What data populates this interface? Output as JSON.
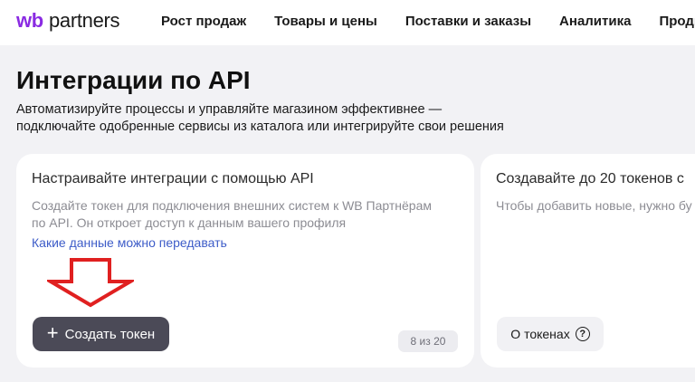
{
  "header": {
    "logo_wb": "wb",
    "logo_partners": "partners",
    "nav": [
      {
        "label": "Рост продаж"
      },
      {
        "label": "Товары и цены"
      },
      {
        "label": "Поставки и заказы"
      },
      {
        "label": "Аналитика"
      },
      {
        "label": "Продви"
      }
    ]
  },
  "page": {
    "title": "Интеграции по API",
    "subtitle_line1": "Автоматизируйте процессы и управляйте магазином эффективнее —",
    "subtitle_line2": "подключайте одобренные сервисы из каталога или интегрируйте свои решения"
  },
  "card_integrations": {
    "title": "Настраивайте интеграции с помощью API",
    "desc_line1": "Создайте токен для подключения внешних систем к WB Партнёрам",
    "desc_line2": "по API. Он откроет доступ к данным вашего профиля",
    "link": "Какие данные можно передавать",
    "button_icon": "plus-icon",
    "button_label": "Создать токен",
    "counter": "8 из 20"
  },
  "card_tokens": {
    "title": "Создавайте до 20 токенов с",
    "desc": "Чтобы добавить новые, нужно бу",
    "button_label": "О токенах",
    "button_icon": "question-icon"
  },
  "annotation": {
    "arrow_icon": "down-arrow-icon",
    "arrow_color": "#e02020"
  },
  "colors": {
    "brand": "#8a2be2",
    "primary_button": "#4b4a57",
    "link": "#3d5cc8",
    "background": "#f2f2f5"
  }
}
